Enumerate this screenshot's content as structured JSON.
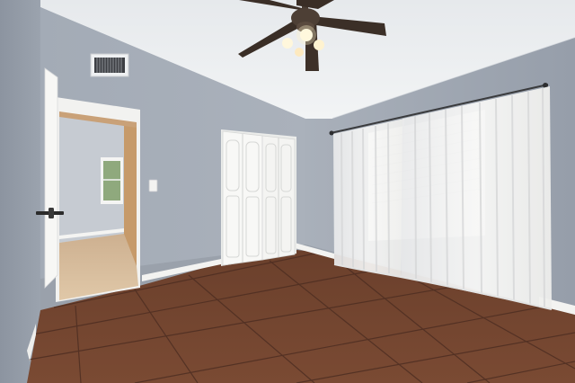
{
  "scene": {
    "kind": "interior photo of an empty bedroom",
    "colors": {
      "wall_left": "#98a0ab",
      "wall_back": "#a6adb8",
      "wall_right": "#9ea6b2",
      "ceiling": "#eceff2",
      "floor_tile": "#6f412c",
      "grout": "#4d2e22",
      "trim": "#f4f4f2",
      "curtain": "#f3f3f1",
      "door": "#f7f7f5",
      "hallway_wall": "#c5cad1",
      "hallway_floor": "#d4b99a",
      "door_frame_wood": "#c79a6b"
    },
    "elements": [
      "ceiling-fan",
      "air-vent",
      "bifold-closet-doors",
      "sheer-curtains",
      "open-door",
      "tile-floor",
      "light-switch",
      "baseboard"
    ]
  }
}
